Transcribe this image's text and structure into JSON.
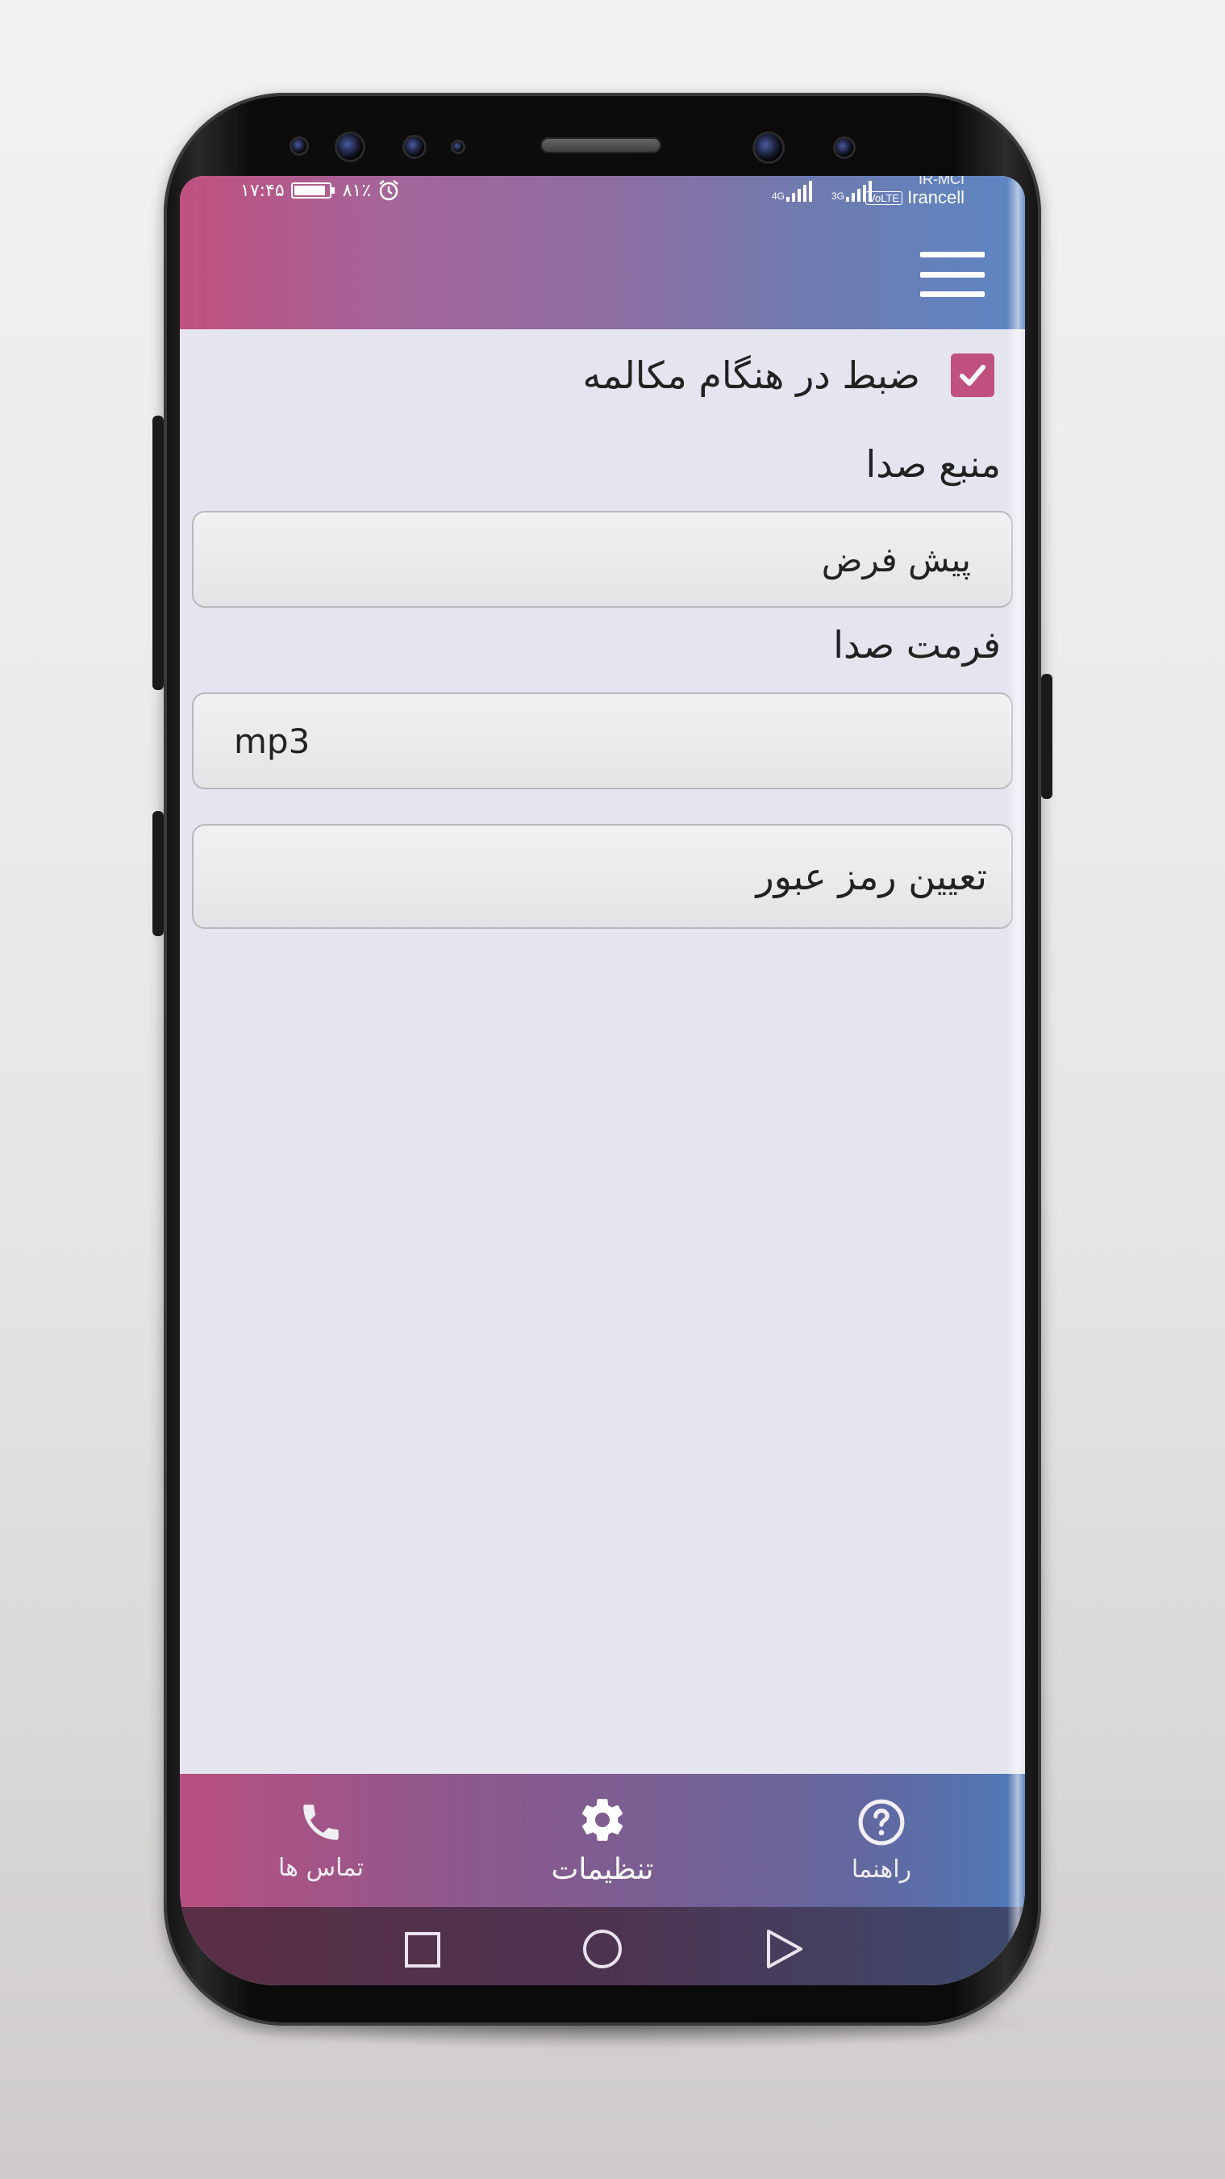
{
  "status_bar": {
    "time": "۱۷:۴۵",
    "battery": "۸۱٪",
    "carrier_1": "IR-MCI",
    "carrier_2": "Irancell",
    "volte": "VoLTE",
    "net_1": "4G",
    "net_2": "3G"
  },
  "header": {
    "menu_icon": "hamburger-menu-icon",
    "gradient_start": "#c0507e",
    "gradient_end": "#5d86c3"
  },
  "settings": {
    "record_during_call": {
      "label": "ضبط در هنگام مکالمه",
      "checked": true
    },
    "audio_source": {
      "label": "منبع صدا",
      "value": "پیش فرض"
    },
    "audio_format": {
      "label": "فرمت صدا",
      "value": "mp3"
    },
    "set_password": {
      "label": "تعیین رمز عبور"
    }
  },
  "bottom_nav": {
    "items": [
      {
        "label": "تماس ها",
        "icon": "phone-icon"
      },
      {
        "label": "تنظیمات",
        "icon": "gear-icon",
        "active": true
      },
      {
        "label": "راهنما",
        "icon": "help-icon"
      }
    ]
  },
  "system_nav": {
    "buttons": [
      "recent-apps-icon",
      "home-icon",
      "back-icon"
    ]
  },
  "colors": {
    "accent": "#c0507e",
    "screen_bg": "#e4e5ef"
  }
}
